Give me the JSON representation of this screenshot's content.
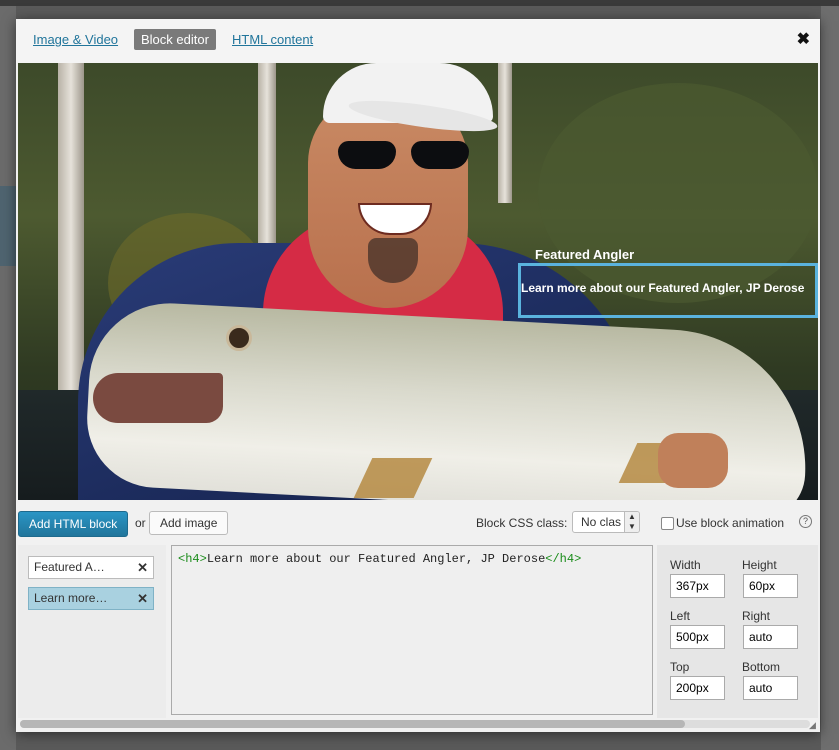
{
  "tabs": [
    {
      "label": "Image & Video",
      "active": false
    },
    {
      "label": "Block editor",
      "active": true
    },
    {
      "label": "HTML content",
      "active": false
    }
  ],
  "close_glyph": "✖",
  "canvas": {
    "overlay_title": "Featured Angler",
    "overlay_block_text": "Learn more about our Featured Angler, JP Derose"
  },
  "toolbar": {
    "add_html_label": "Add HTML block",
    "or_label": "or",
    "add_image_label": "Add image",
    "css_class_label": "Block CSS class:",
    "css_class_value": "No clas",
    "animation_label": "Use block animation",
    "help_glyph": "?"
  },
  "blocks": [
    {
      "label": "Featured A…",
      "selected": false
    },
    {
      "label": "Learn more…",
      "selected": true
    }
  ],
  "remove_glyph": "✕",
  "editor": {
    "open_tag": "<h4>",
    "content": "Learn more about our Featured Angler, JP Derose",
    "close_tag": "</h4>"
  },
  "props": {
    "width_label": "Width",
    "width_value": "367px",
    "height_label": "Height",
    "height_value": "60px",
    "left_label": "Left",
    "left_value": "500px",
    "right_label": "Right",
    "right_value": "auto",
    "top_label": "Top",
    "top_value": "200px",
    "bottom_label": "Bottom",
    "bottom_value": "auto"
  },
  "colors": {
    "accent": "#21759b",
    "selection_border": "#5ab3de",
    "selected_item": "#a9d1e0",
    "code_tag": "#1a8c1a"
  }
}
